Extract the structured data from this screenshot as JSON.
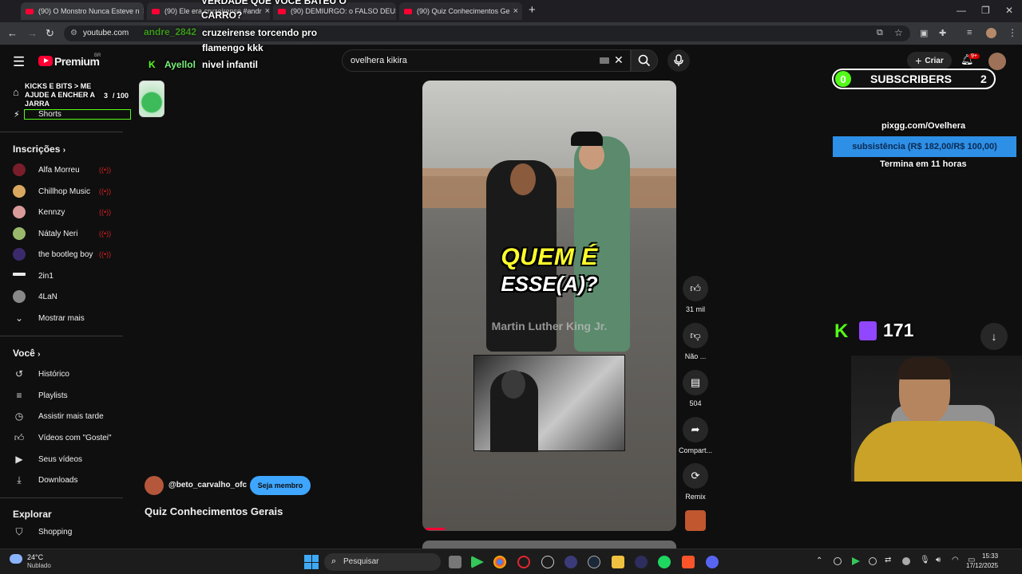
{
  "browser": {
    "tabs": [
      {
        "title": "(90) O Monstro Nunca Esteve n"
      },
      {
        "title": "(90) Ele era cruzeirense #andr"
      },
      {
        "title": "(90) DEMIURGO: o FALSO DEUS"
      },
      {
        "title": "(90) Quiz Conhecimentos Ge"
      }
    ],
    "new_tab": "+",
    "url": "youtube.com"
  },
  "youtube": {
    "logo_label": "Premium",
    "logo_badge": "BR",
    "search_value": "ovelhera kikira",
    "create_label": "Criar",
    "notif_count": "9+"
  },
  "sidebar": {
    "shorts_label": "Shorts",
    "subs_title": "Inscrições",
    "subs": [
      {
        "label": "Alfa Morreu",
        "color": "#7a1d2a"
      },
      {
        "label": "Chillhop Music",
        "color": "#d9a860"
      },
      {
        "label": "Kennzy",
        "color": "#d99a9a"
      },
      {
        "label": "Nátaly Neri",
        "color": "#9ab86b"
      },
      {
        "label": "the bootleg boy",
        "color": "#3b2a6b"
      },
      {
        "label": "2in1",
        "color": "#e9e9e9"
      },
      {
        "label": "4LaN",
        "color": "#888"
      }
    ],
    "show_more": "Mostrar mais",
    "you_title": "Você",
    "you_items": [
      "Histórico",
      "Playlists",
      "Assistir mais tarde",
      "Vídeos com \"Gostei\"",
      "Seus vídeos",
      "Downloads"
    ],
    "explore_title": "Explorar",
    "explore_items": [
      "Shopping"
    ]
  },
  "overlay": {
    "chat_user1": "andre_2842",
    "chat_msg1_top": "VERDADE QUE VOCÊ BATEU O",
    "chat_msg1": "CARRO?",
    "chat_msg2_l1": "cruzeirense torcendo pro",
    "chat_msg2_l2": "flamengo kkk",
    "chat_user2": "Ayellol",
    "chat_msg3": "nivel infantil",
    "jar_title": "KICKS E BITS > ME AJUDE A ENCHER A JARRA",
    "jar_count": "3",
    "jar_total": "/ 100",
    "subs_count": "0",
    "subs_label": "SUBSCRIBERS",
    "subs_goal": "2",
    "pix_url": "pixgg.com/Ovelhera",
    "goal_label": "subsistência (R$ 182,00/R$ 100,00)",
    "goal_ends": "Termina em 11 horas",
    "viewers": "171"
  },
  "short": {
    "caption_l1": "QUEM É",
    "caption_l2": "ESSE(A)?",
    "answer": "Martin Luther King Jr.",
    "channel": "@beto_carvalho_ofc",
    "member_btn": "Seja membro",
    "title": "Quiz Conhecimentos Gerais",
    "likes": "31 mil",
    "dislike": "Não ...",
    "comments": "504",
    "share": "Compart...",
    "remix": "Remix"
  },
  "taskbar": {
    "weather_temp": "24°C",
    "weather_desc": "Nublado",
    "search_placeholder": "Pesquisar",
    "time": "15:33",
    "date": "17/12/2025"
  },
  "colors": {
    "accent_red": "#ff0033",
    "kick_green": "#53fc18",
    "goal_blue": "#2e8fe6",
    "member_blue": "#3ea6ff"
  }
}
